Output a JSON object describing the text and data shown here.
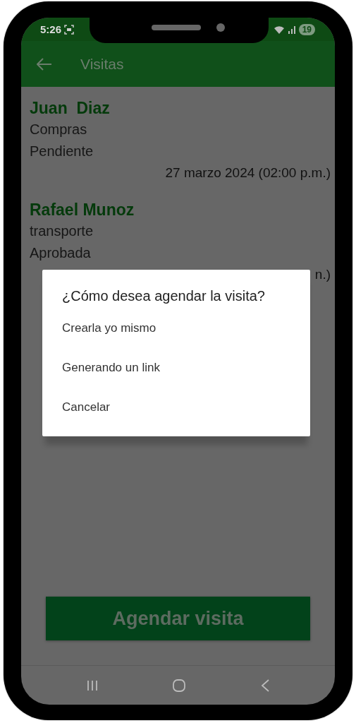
{
  "status_bar": {
    "time": "5:26",
    "battery": "19"
  },
  "app_bar": {
    "title": "Visitas"
  },
  "visits": [
    {
      "name": "Juan  Diaz",
      "category": "Compras",
      "status": "Pendiente",
      "date": "27 marzo 2024 (02:00 p.m.)"
    },
    {
      "name": "Rafael Munoz",
      "category": "transporte",
      "status": "Aprobada",
      "date": "n.)"
    }
  ],
  "dialog": {
    "title": "¿Cómo desea agendar la visita?",
    "options": [
      "Crearla yo mismo",
      "Generando un link",
      "Cancelar"
    ]
  },
  "primary_button": {
    "label": "Agendar visita"
  }
}
